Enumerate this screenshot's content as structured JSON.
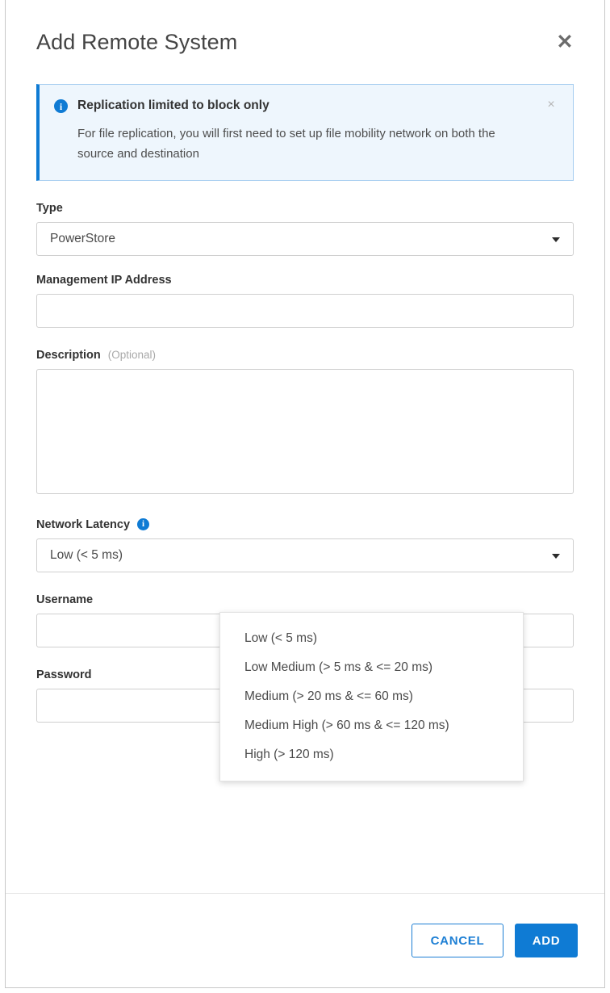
{
  "dialog": {
    "title": "Add Remote System",
    "close_icon": "✕"
  },
  "banner": {
    "icon": "i",
    "title": "Replication limited to block only",
    "text": "For file replication, you will first need to set up file mobility network on both the source and destination",
    "close_icon": "×",
    "accent_color": "#0f7bd4",
    "background_color": "#eef6fd"
  },
  "fields": {
    "type": {
      "label": "Type",
      "value": "PowerStore"
    },
    "management_ip": {
      "label": "Management IP Address",
      "value": "",
      "placeholder": ""
    },
    "description": {
      "label": "Description",
      "optional_tag": "(Optional)",
      "value": "",
      "placeholder": ""
    },
    "network_latency": {
      "label": "Network Latency",
      "info_icon": "i",
      "value": "Low (< 5 ms)",
      "options": [
        "Low (< 5 ms)",
        "Low Medium (> 5 ms & <= 20 ms)",
        "Medium (> 20 ms & <= 60 ms)",
        "Medium High (> 60 ms & <= 120 ms)",
        "High (> 120 ms)"
      ]
    },
    "username": {
      "label": "Username",
      "value": "",
      "placeholder": ""
    },
    "password": {
      "label": "Password",
      "value": "",
      "placeholder": ""
    }
  },
  "footer": {
    "cancel_label": "CANCEL",
    "add_label": "ADD",
    "primary_color": "#0f7bd4"
  }
}
